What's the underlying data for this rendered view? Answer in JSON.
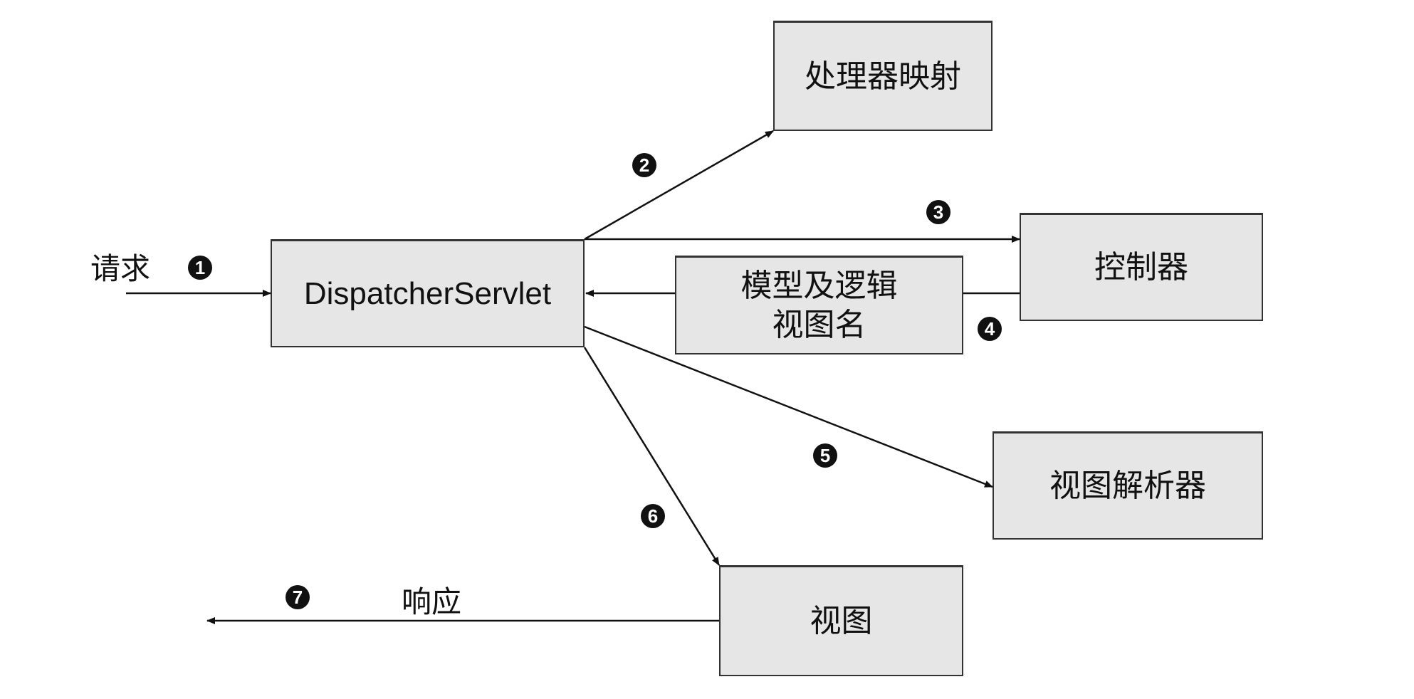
{
  "nodes": {
    "dispatcher": "DispatcherServlet",
    "handler_mapping": "处理器映射",
    "controller": "控制器",
    "model_view": "模型及逻辑\n视图名",
    "view_resolver": "视图解析器",
    "view": "视图"
  },
  "labels": {
    "request": "请求",
    "response": "响应"
  },
  "steps": [
    "1",
    "2",
    "3",
    "4",
    "5",
    "6",
    "7"
  ],
  "colors": {
    "box_fill": "#e6e6e6",
    "line": "#111111"
  }
}
